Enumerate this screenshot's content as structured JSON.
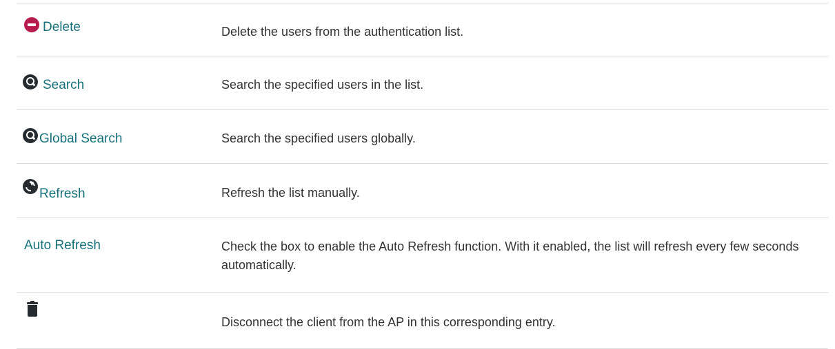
{
  "rows": [
    {
      "name": "Delete",
      "icon": "delete-icon",
      "description": "Delete the users from the authentication list."
    },
    {
      "name": "Search",
      "icon": "search-icon",
      "description": "Search the specified users in the list."
    },
    {
      "name": "Global Search",
      "icon": "global-search-icon",
      "description": "Search the specified users globally."
    },
    {
      "name": "Refresh",
      "icon": "refresh-icon",
      "description": "Refresh the list manually."
    },
    {
      "name": "Auto Refresh",
      "icon": "",
      "description": "Check the box to enable the Auto Refresh function. With it enabled, the list will refresh every few seconds automatically."
    },
    {
      "name": "",
      "icon": "trash-icon",
      "description": "Disconnect the client from the AP in this corresponding entry."
    }
  ],
  "colors": {
    "link": "#16707a",
    "text": "#333333",
    "delete_icon": "#b71c4f",
    "icon_dark": "#262b30",
    "divider": "#dcdcdc"
  }
}
